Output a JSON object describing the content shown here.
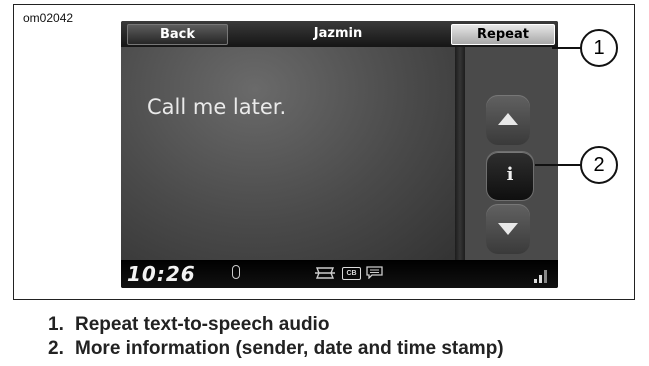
{
  "figure": {
    "id": "om02042"
  },
  "topbar": {
    "back_label": "Back",
    "title": "Jazmin",
    "repeat_label": "Repeat"
  },
  "message": {
    "text": "Call me later."
  },
  "side_buttons": {
    "up_icon": "arrow-up-icon",
    "info_label": "i",
    "down_icon": "arrow-down-icon"
  },
  "statusbar": {
    "time": "10:26",
    "icons": [
      "microphone-icon",
      "brand-logo-icon",
      "cb-icon",
      "message-icon",
      "signal-strength-icon"
    ],
    "cb_label": "CB"
  },
  "callouts": [
    {
      "number": "1"
    },
    {
      "number": "2"
    }
  ],
  "legend": [
    {
      "number": "1.",
      "text": "Repeat text-to-speech audio"
    },
    {
      "number": "2.",
      "text": "More information (sender, date and time stamp)"
    }
  ]
}
